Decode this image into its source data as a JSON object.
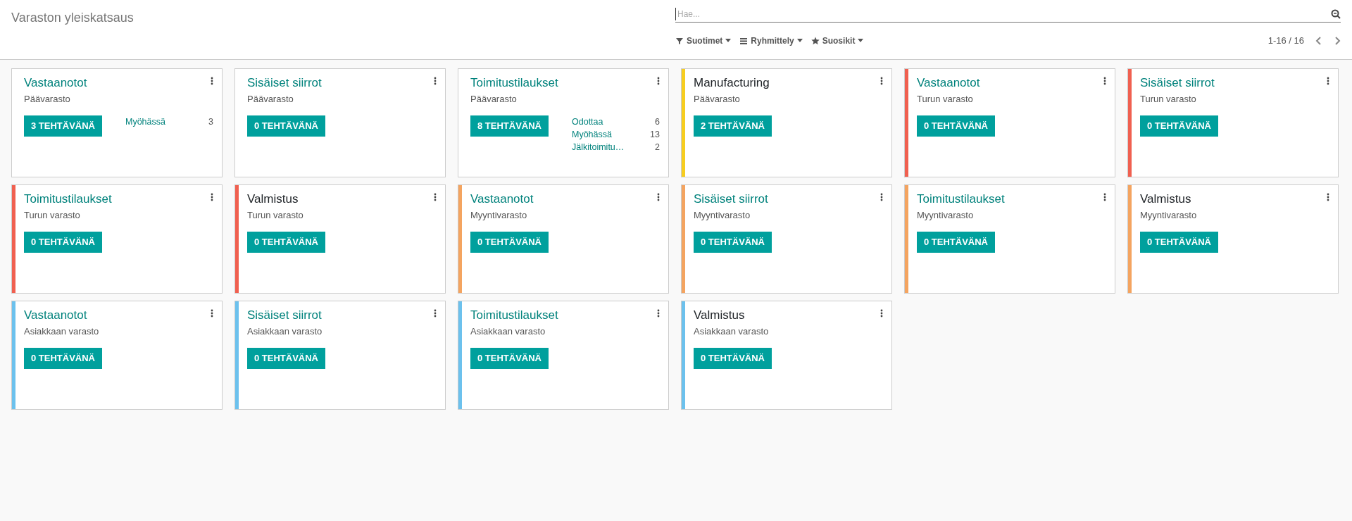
{
  "breadcrumb": "Varaston yleiskatsaus",
  "search": {
    "placeholder": "Hae..."
  },
  "filters": [
    {
      "label": "Suotimet",
      "kind": "filter"
    },
    {
      "label": "Ryhmittely",
      "kind": "group"
    },
    {
      "label": "Suosikit",
      "kind": "star"
    }
  ],
  "pager": "1-16 / 16",
  "cards": [
    {
      "title": "Vastaanotot",
      "kind": "transfer",
      "warehouse": "Päävarasto",
      "button": "3 TEHTÄVÄNÄ",
      "stats": [
        {
          "label": "Myöhässä",
          "count": "3"
        }
      ]
    },
    {
      "title": "Sisäiset siirrot",
      "kind": "transfer",
      "warehouse": "Päävarasto",
      "button": "0 TEHTÄVÄNÄ"
    },
    {
      "title": "Toimitustilaukset",
      "kind": "transfer",
      "warehouse": "Päävarasto",
      "button": "8 TEHTÄVÄNÄ",
      "stats": [
        {
          "label": "Odottaa",
          "count": "6"
        },
        {
          "label": "Myöhässä",
          "count": "13"
        },
        {
          "label": "Jälkitoimitu…",
          "count": "2"
        }
      ]
    },
    {
      "title": "Manufacturing",
      "kind": "manufacturing",
      "warehouse": "Päävarasto",
      "button": "2 TEHTÄVÄNÄ",
      "color": "#f7cd1f"
    },
    {
      "title": "Vastaanotot",
      "kind": "transfer",
      "warehouse": "Turun varasto",
      "button": "0 TEHTÄVÄNÄ",
      "color": "#f06050"
    },
    {
      "title": "Sisäiset siirrot",
      "kind": "transfer",
      "warehouse": "Turun varasto",
      "button": "0 TEHTÄVÄNÄ",
      "color": "#f06050"
    },
    {
      "title": "Toimitustilaukset",
      "kind": "transfer",
      "warehouse": "Turun varasto",
      "button": "0 TEHTÄVÄNÄ",
      "color": "#f06050"
    },
    {
      "title": "Valmistus",
      "kind": "manufacturing",
      "warehouse": "Turun varasto",
      "button": "0 TEHTÄVÄNÄ",
      "color": "#f06050"
    },
    {
      "title": "Vastaanotot",
      "kind": "transfer",
      "warehouse": "Myyntivarasto",
      "button": "0 TEHTÄVÄNÄ",
      "color": "#f4a460"
    },
    {
      "title": "Sisäiset siirrot",
      "kind": "transfer",
      "warehouse": "Myyntivarasto",
      "button": "0 TEHTÄVÄNÄ",
      "color": "#f4a460"
    },
    {
      "title": "Toimitustilaukset",
      "kind": "transfer",
      "warehouse": "Myyntivarasto",
      "button": "0 TEHTÄVÄNÄ",
      "color": "#f4a460"
    },
    {
      "title": "Valmistus",
      "kind": "manufacturing",
      "warehouse": "Myyntivarasto",
      "button": "0 TEHTÄVÄNÄ",
      "color": "#f4a460"
    },
    {
      "title": "Vastaanotot",
      "kind": "transfer",
      "warehouse": "Asiakkaan varasto",
      "button": "0 TEHTÄVÄNÄ",
      "color": "#6cc1ed"
    },
    {
      "title": "Sisäiset siirrot",
      "kind": "transfer",
      "warehouse": "Asiakkaan varasto",
      "button": "0 TEHTÄVÄNÄ",
      "color": "#6cc1ed"
    },
    {
      "title": "Toimitustilaukset",
      "kind": "transfer",
      "warehouse": "Asiakkaan varasto",
      "button": "0 TEHTÄVÄNÄ",
      "color": "#6cc1ed"
    },
    {
      "title": "Valmistus",
      "kind": "manufacturing",
      "warehouse": "Asiakkaan varasto",
      "button": "0 TEHTÄVÄNÄ",
      "color": "#6cc1ed"
    }
  ]
}
